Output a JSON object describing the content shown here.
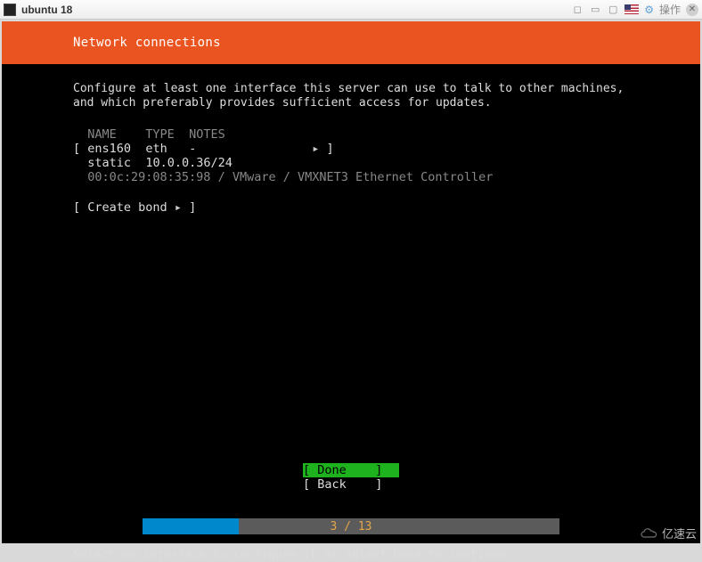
{
  "window": {
    "title": "ubuntu 18",
    "op_label": "操作"
  },
  "installer": {
    "header": "Network connections",
    "description": "Configure at least one interface this server can use to talk to other machines, and which preferably provides sufficient access for updates.",
    "columns": {
      "name": "NAME",
      "type": "TYPE",
      "notes": "NOTES"
    },
    "interface": {
      "name": "ens160",
      "type": "eth",
      "notes": "-",
      "mode": "static",
      "addr": "10.0.0.36/24",
      "hw": "00:0c:29:08:35:98 / VMware / VMXNET3 Ethernet Controller"
    },
    "create_bond": "Create bond",
    "done": "Done",
    "back": "Back",
    "progress": {
      "current": 3,
      "total": 13,
      "text": "3 / 13"
    },
    "hint": "Select an interface to configure it or select Done to continue"
  },
  "watermark": "亿速云"
}
